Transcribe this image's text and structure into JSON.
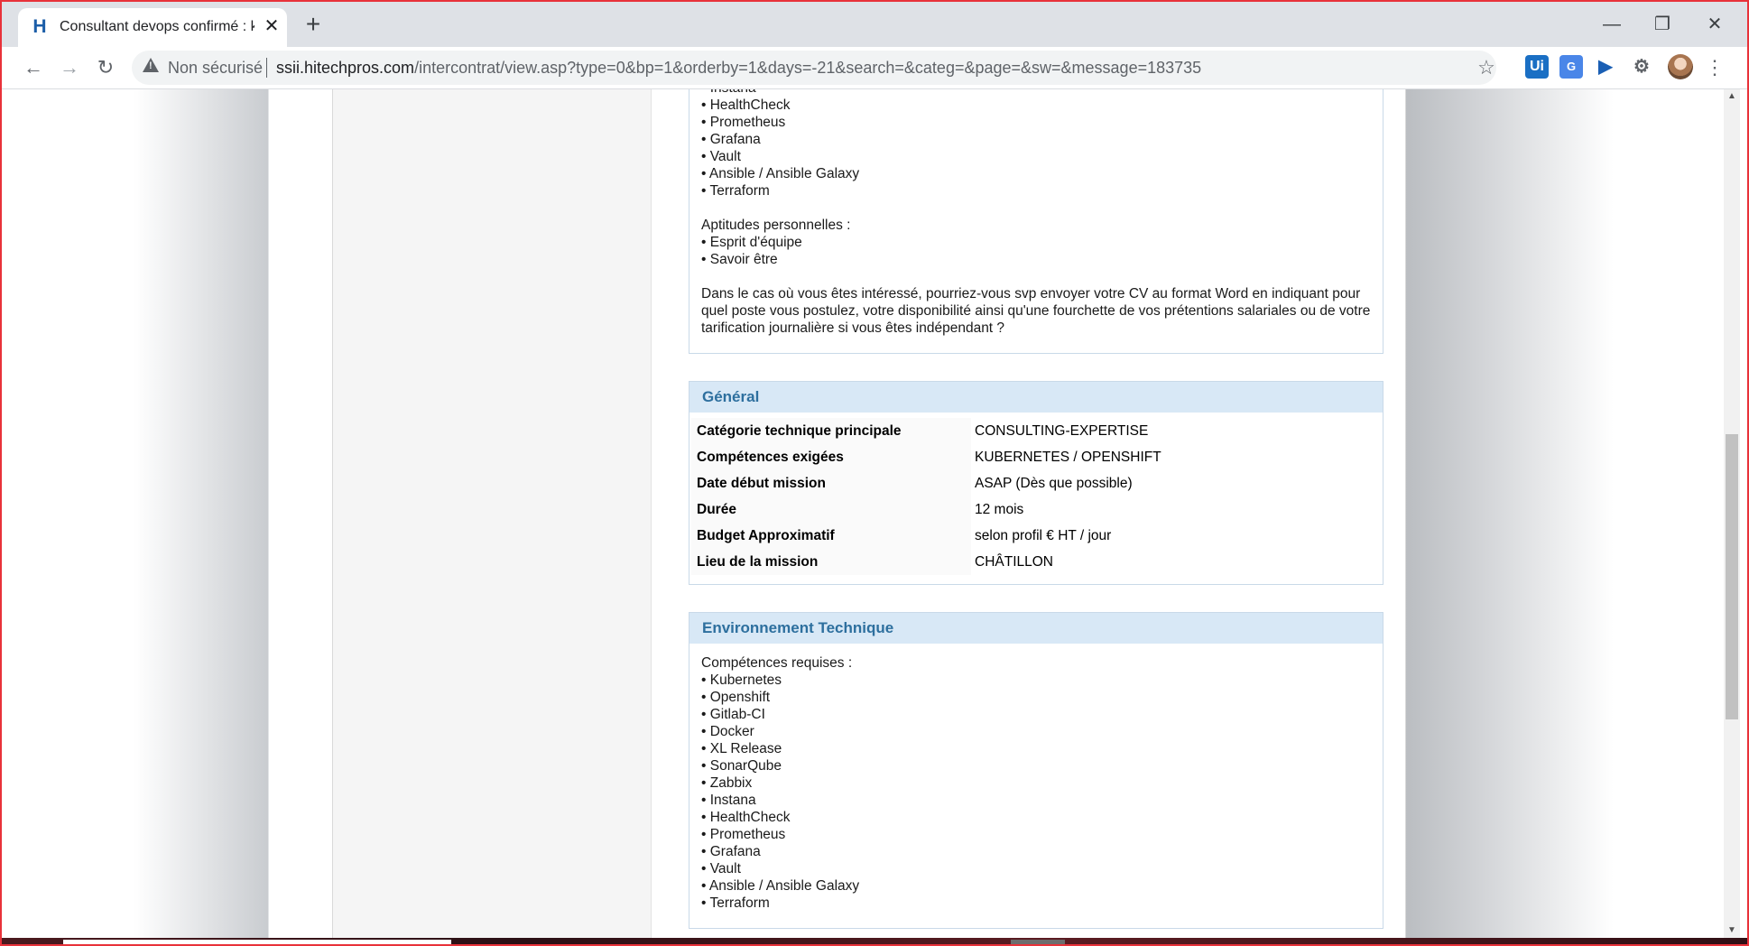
{
  "browser": {
    "tab_title": "Consultant devops confirmé : kub",
    "tab_favicon": "H",
    "tab_close": "✕",
    "new_tab": "+",
    "security_label": "Non sécurisé",
    "url_host": "ssii.hitechpros.com",
    "url_path": "/intercontrat/view.asp?type=0&bp=1&orderby=1&days=-21&search=&categ=&page=&sw=&message=183735",
    "extensions": [
      "Ui",
      "G",
      "▶",
      "puzzle"
    ]
  },
  "description_tail": {
    "partial_line": "• Instana",
    "tools": [
      "• HealthCheck",
      "• Prometheus",
      "• Grafana",
      "• Vault",
      "• Ansible / Ansible Galaxy",
      "• Terraform"
    ],
    "aptitudes_title": "Aptitudes personnelles :",
    "aptitudes": [
      "• Esprit d'équipe",
      "• Savoir être"
    ],
    "closing": "Dans le cas où vous êtes intéressé, pourriez-vous svp envoyer votre CV au format Word en indiquant pour quel poste vous postulez, votre disponibilité ainsi qu'une fourchette de vos prétentions salariales ou de votre tarification journalière si vous êtes indépendant ?"
  },
  "general": {
    "title": "Général",
    "rows": [
      {
        "label": "Catégorie technique principale",
        "value": "CONSULTING-EXPERTISE"
      },
      {
        "label": "Compétences exigées",
        "value": "KUBERNETES / OPENSHIFT"
      },
      {
        "label": "Date début mission",
        "value": "ASAP (Dès que possible)"
      },
      {
        "label": "Durée",
        "value": "12 mois"
      },
      {
        "label": "Budget Approximatif",
        "value": "selon profil € HT / jour"
      },
      {
        "label": "Lieu de la mission",
        "value": "CHÂTILLON"
      }
    ]
  },
  "environment": {
    "title": "Environnement Technique",
    "intro": "Compétences requises :",
    "items": [
      "• Kubernetes",
      "• Openshift",
      "• Gitlab-CI",
      "• Docker",
      "• XL Release",
      "• SonarQube",
      "• Zabbix",
      "• Instana",
      "• HealthCheck",
      "• Prometheus",
      "• Grafana",
      "• Vault",
      "• Ansible / Ansible Galaxy",
      "• Terraform"
    ]
  },
  "colors": {
    "section_header_bg": "#d8e8f6",
    "section_header_text": "#2d6f9e",
    "frame_border": "#e8323a"
  }
}
